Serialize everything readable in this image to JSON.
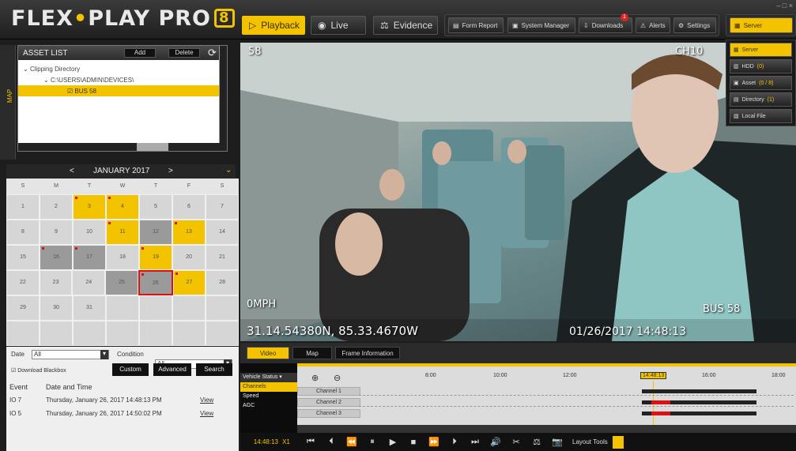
{
  "app": {
    "logo_text": "FLEX",
    "logo_dot": "•",
    "logo_text2": "PLAY PRO",
    "logo_badge": "8"
  },
  "nav": {
    "playback": "Playback",
    "live": "Live",
    "evidence": "Evidence"
  },
  "toolbar": {
    "form_report": "Form Report",
    "system_manager": "System Manager",
    "downloads": "Downloads",
    "alerts": "Alerts",
    "settings": "Settings",
    "server": "Server",
    "downloads_badge": "1"
  },
  "server_menu": {
    "server": "Server",
    "hdd": "HDD",
    "hdd_count": "(0)",
    "asset": "Asset",
    "asset_count": "(0 / 8)",
    "directory": "Directory",
    "directory_count": "(1)",
    "local_file": "Local File"
  },
  "asset_list": {
    "title": "ASSET LIST",
    "add": "Add",
    "delete": "Delete",
    "map_tab": "MAP",
    "tree": [
      "Clipping Directory",
      "C:\\USERS\\ADMIN\\DEVICES\\",
      "BUS 58"
    ]
  },
  "calendar": {
    "month": "JANUARY 2017",
    "prev": "<",
    "next": ">",
    "dow": [
      "S",
      "M",
      "T",
      "W",
      "T",
      "F",
      "S"
    ],
    "weeks": [
      [
        {
          "d": "1"
        },
        {
          "d": "2"
        },
        {
          "d": "3",
          "s": "y",
          "m": 1
        },
        {
          "d": "4",
          "s": "y",
          "m": 1
        },
        {
          "d": "5"
        },
        {
          "d": "6"
        },
        {
          "d": "7"
        }
      ],
      [
        {
          "d": "8"
        },
        {
          "d": "9"
        },
        {
          "d": "10"
        },
        {
          "d": "11",
          "s": "y",
          "m": 1
        },
        {
          "d": "12",
          "s": "g"
        },
        {
          "d": "13",
          "s": "y",
          "m": 1
        },
        {
          "d": "14"
        }
      ],
      [
        {
          "d": "15"
        },
        {
          "d": "16",
          "s": "g",
          "m": 1
        },
        {
          "d": "17",
          "s": "g",
          "m": 1
        },
        {
          "d": "18"
        },
        {
          "d": "19",
          "s": "y",
          "m": 1
        },
        {
          "d": "20"
        },
        {
          "d": "21"
        }
      ],
      [
        {
          "d": "22"
        },
        {
          "d": "23"
        },
        {
          "d": "24"
        },
        {
          "d": "25",
          "s": "g"
        },
        {
          "d": "26",
          "s": "g",
          "sel": 1,
          "m": 1
        },
        {
          "d": "27",
          "s": "y",
          "m": 1
        },
        {
          "d": "28"
        }
      ],
      [
        {
          "d": "29"
        },
        {
          "d": "30"
        },
        {
          "d": "31"
        },
        {
          "d": ""
        },
        {
          "d": ""
        },
        {
          "d": ""
        },
        {
          "d": ""
        }
      ],
      [
        {
          "d": ""
        },
        {
          "d": ""
        },
        {
          "d": ""
        },
        {
          "d": ""
        },
        {
          "d": ""
        },
        {
          "d": ""
        },
        {
          "d": ""
        }
      ]
    ]
  },
  "filter": {
    "date_label": "Date",
    "date_value": "All",
    "condition_label": "Condition",
    "condition_value": "All",
    "download_blackbox": "Download Blackbox",
    "custom": "Custom",
    "advanced": "Advanced",
    "search": "Search"
  },
  "events": {
    "col_event": "Event",
    "col_datetime": "Date and Time",
    "rows": [
      {
        "event": "IO 7",
        "datetime": "Thursday, January 26, 2017  14:48:13 PM",
        "action": "View"
      },
      {
        "event": "IO 5",
        "datetime": "Thursday, January 26, 2017  14:50:02 PM",
        "action": "View"
      }
    ]
  },
  "video": {
    "cam_num": "58",
    "channel": "CH10",
    "speed": "0MPH",
    "gps": "31.14.54380N, 85.33.4670W",
    "timestamp": "01/26/2017 14:48:13",
    "bus": "BUS 58"
  },
  "bottom_tabs": {
    "video": "Video",
    "map": "Map",
    "frame_info": "Frame Information"
  },
  "timeline": {
    "vehicle_status": "Vehicle Status ▾",
    "items": [
      "Channels",
      "Speed",
      "AGC"
    ],
    "times": [
      "8:00",
      "10:00",
      "12:00",
      "14:48:13",
      "16:00",
      "18:00"
    ],
    "channels": [
      "Channel 1",
      "Channel 2",
      "Channel 3"
    ]
  },
  "controls": {
    "time": "14:48:13",
    "speed": "X1",
    "layout_tools": "Layout Tools"
  },
  "window": {
    "controls": "– □ ×"
  }
}
